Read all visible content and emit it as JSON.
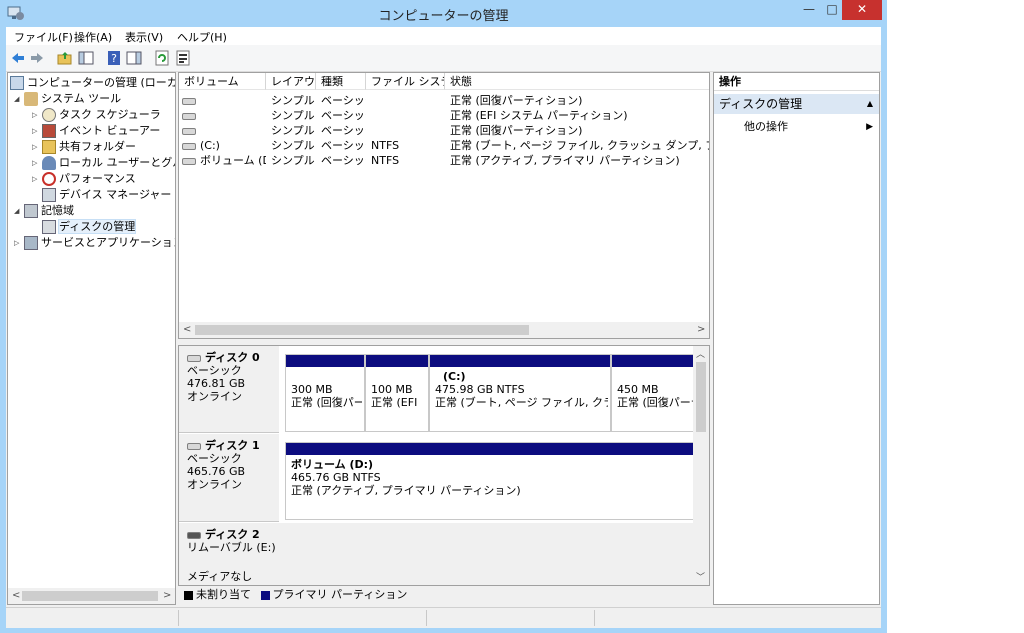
{
  "window": {
    "title": "コンピューターの管理",
    "min_label": "—",
    "max_label": "□",
    "close_label": "✕"
  },
  "menu": [
    "ファイル(F)",
    "操作(A)",
    "表示(V)",
    "ヘルプ(H)"
  ],
  "toolbar_icons": [
    "back-icon",
    "forward-icon",
    "up-folder-icon",
    "show-hide-tree-icon",
    "help-icon",
    "show-hide-action-pane-icon",
    "refresh-icon",
    "properties-icon"
  ],
  "tree": {
    "root": "コンピューターの管理 (ローカル)",
    "system_tools": "システム ツール",
    "task_scheduler": "タスク スケジューラ",
    "event_viewer": "イベント ビューアー",
    "shared_folders": "共有フォルダー",
    "local_users": "ローカル ユーザーとグループ",
    "performance": "パフォーマンス",
    "device_manager": "デバイス マネージャー",
    "storage": "記憶域",
    "disk_management": "ディスクの管理",
    "services_apps": "サービスとアプリケーション"
  },
  "volumes": {
    "columns": [
      "ボリューム",
      "レイアウト",
      "種類",
      "ファイル システム",
      "状態"
    ],
    "rows": [
      {
        "volume": "",
        "layout": "シンプル",
        "type": "ベーシック",
        "fs": "",
        "status": "正常 (回復パーティション)"
      },
      {
        "volume": "",
        "layout": "シンプル",
        "type": "ベーシック",
        "fs": "",
        "status": "正常 (EFI システム パーティション)"
      },
      {
        "volume": "",
        "layout": "シンプル",
        "type": "ベーシック",
        "fs": "",
        "status": "正常 (回復パーティション)"
      },
      {
        "volume": "(C:)",
        "layout": "シンプル",
        "type": "ベーシック",
        "fs": "NTFS",
        "status": "正常 (ブート, ページ ファイル, クラッシュ ダンプ, プライマリ パー"
      },
      {
        "volume": "ボリューム (D:)",
        "layout": "シンプル",
        "type": "ベーシック",
        "fs": "NTFS",
        "status": "正常 (アクティブ, プライマリ パーティション)"
      }
    ]
  },
  "disks": [
    {
      "name": "ディスク 0",
      "kind": "ベーシック",
      "size": "476.81 GB",
      "state": "オンライン",
      "partitions": [
        {
          "name": "",
          "size": "300 MB",
          "status": "正常 (回復パー"
        },
        {
          "name": "",
          "size": "100 MB",
          "status": "正常 (EFI"
        },
        {
          "name": "(C:)",
          "size": "475.98 GB NTFS",
          "status": "正常 (ブート, ページ ファイル, クラッシュ"
        },
        {
          "name": "",
          "size": "450 MB",
          "status": "正常 (回復パーテ"
        }
      ]
    },
    {
      "name": "ディスク 1",
      "kind": "ベーシック",
      "size": "465.76 GB",
      "state": "オンライン",
      "partitions": [
        {
          "name": "ボリューム (D:)",
          "size": "465.76 GB NTFS",
          "status": "正常 (アクティブ, プライマリ パーティション)"
        }
      ]
    },
    {
      "name": "ディスク 2",
      "kind": "リムーバブル (E:)",
      "size": "",
      "state": "メディアなし",
      "partitions": []
    }
  ],
  "legend": {
    "unallocated": "未割り当て",
    "primary": "プライマリ パーティション",
    "unallocated_color": "#000000",
    "primary_color": "#0c0c7f"
  },
  "actions": {
    "header": "操作",
    "section": "ディスクの管理",
    "other": "他の操作",
    "section_color": "#dbe7f4"
  },
  "scroll_arrows": {
    "left": "<",
    "right": ">",
    "up": "︿",
    "down": "﹀"
  }
}
